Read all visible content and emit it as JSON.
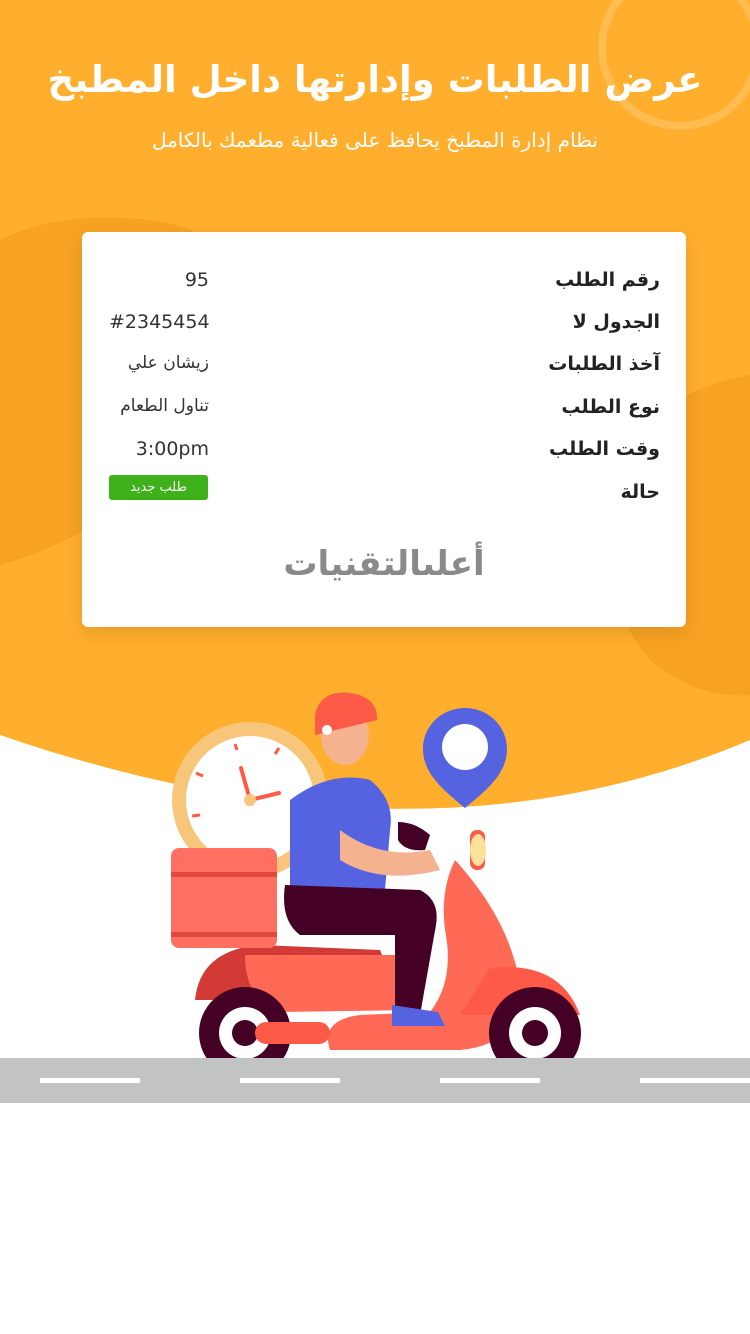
{
  "header": {
    "title": "عرض الطلبات وإدارتها داخل المطبخ",
    "subtitle": "نظام إدارة المطبخ يحافظ على فعالية مطعمك بالكامل"
  },
  "order_card": {
    "rows": [
      {
        "label": "رقم الطلب",
        "value": "95"
      },
      {
        "label": "الجدول لا",
        "value": "#2345454"
      },
      {
        "label": "آخذ الطلبات",
        "value": "زيشان علي"
      },
      {
        "label": "نوع الطلب",
        "value": "تناول الطعام"
      },
      {
        "label": "وقت الطلب",
        "value": "3:00pm"
      },
      {
        "label": "حالة",
        "value": "طلب جديد"
      }
    ],
    "brand": "أعلىالتقنيات"
  },
  "colors": {
    "primary": "#FFAE2D",
    "status_new": "#3DB01A",
    "scooter": "#FF5A47",
    "pin": "#5563E0"
  },
  "icons": [
    "clock-icon",
    "location-pin-icon",
    "delivery-scooter-illustration"
  ]
}
